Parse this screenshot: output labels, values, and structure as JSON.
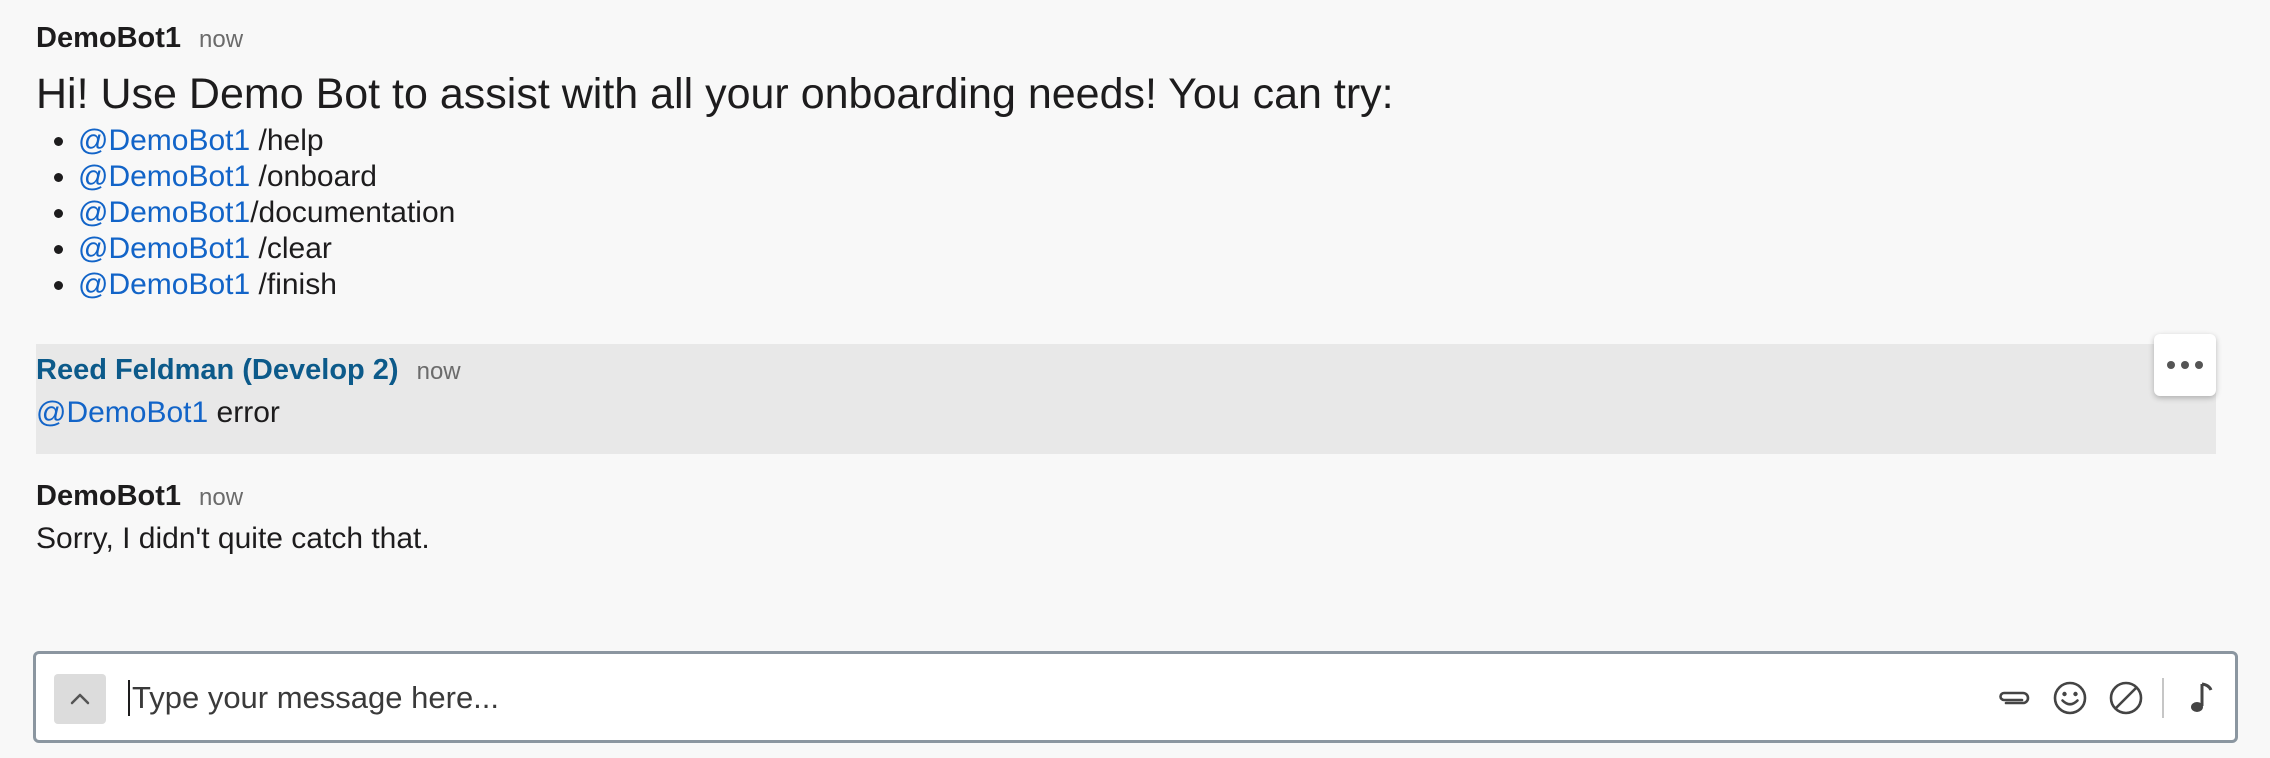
{
  "messages": [
    {
      "sender": "DemoBot1",
      "time": "now",
      "intro": "Hi! Use Demo Bot to assist with all your onboarding needs! You can try:",
      "commands": [
        {
          "mention": "@DemoBot1",
          "command": " /help"
        },
        {
          "mention": "@DemoBot1",
          "command": " /onboard"
        },
        {
          "mention": "@DemoBot1",
          "command": "/documentation"
        },
        {
          "mention": "@DemoBot1",
          "command": " /clear"
        },
        {
          "mention": "@DemoBot1",
          "command": " /finish"
        }
      ]
    },
    {
      "sender": "Reed Feldman (Develop 2)",
      "time": "now",
      "mention": "@DemoBot1",
      "text": " error"
    },
    {
      "sender": "DemoBot1",
      "time": "now",
      "text": "Sorry, I didn't quite catch that."
    }
  ],
  "composer": {
    "placeholder": "Type your message here...",
    "icons": {
      "expand": "chevron-up-icon",
      "attach": "paperclip-icon",
      "emoji": "emoji-icon",
      "block": "block-icon",
      "audio": "music-note-icon"
    }
  },
  "colors": {
    "mention": "#1264c8",
    "user_name": "#0c5a8a",
    "highlight_bg": "#e8e8e8",
    "page_bg": "#f8f8f8"
  }
}
